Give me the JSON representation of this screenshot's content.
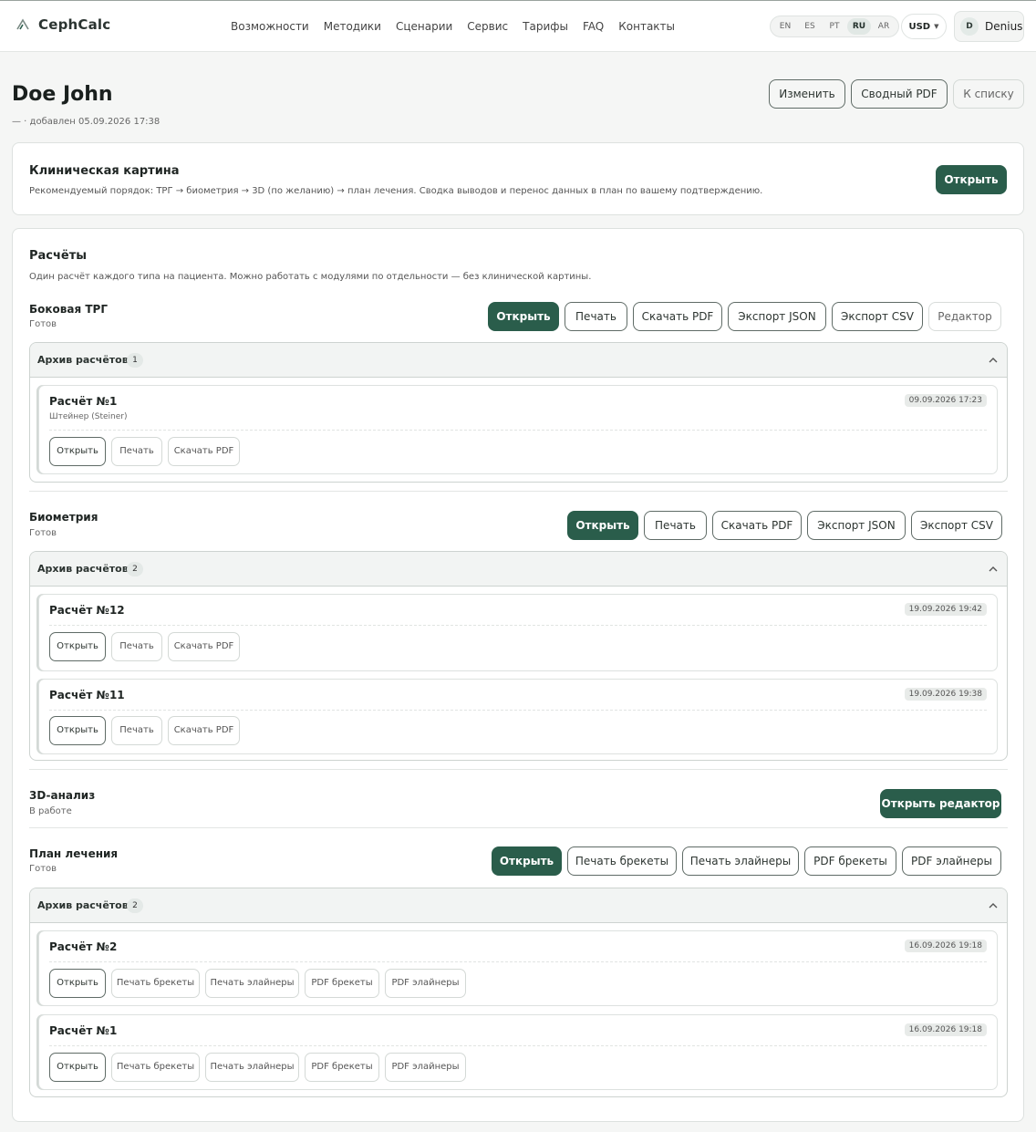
{
  "app": {
    "brand": "CephCalc"
  },
  "nav": [
    "Возможности",
    "Методики",
    "Сценарии",
    "Сервис",
    "Тарифы",
    "FAQ",
    "Контакты"
  ],
  "languages": {
    "items": [
      "EN",
      "ES",
      "PT",
      "RU",
      "AR"
    ],
    "active": "RU"
  },
  "currency": "USD",
  "user": {
    "initial": "D",
    "name": "Denius"
  },
  "patient": {
    "name": "Doe John",
    "subtitle": "— · добавлен 05.09.2026 17:38"
  },
  "header_actions": {
    "edit": "Изменить",
    "summary_pdf": "Сводный PDF",
    "back": "К списку"
  },
  "clinical": {
    "title": "Клиническая картина",
    "description": "Рекомендуемый порядок: ТРГ → биометрия → 3D (по желанию) → план лечения. Сводка выводов и перенос данных в план по вашему подтверждению.",
    "open": "Открыть"
  },
  "calcs": {
    "title": "Расчёты",
    "description": "Один расчёт каждого типа на пациента. Можно работать с модулями по отдельности — без клинической картины.",
    "archive_title": "Архив расчётов",
    "trg": {
      "name": "Боковая ТРГ",
      "status": "Готов",
      "buttons": [
        "Открыть",
        "Печать",
        "Скачать PDF",
        "Экспорт JSON",
        "Экспорт CSV",
        "Редактор"
      ],
      "archive_count": "1",
      "items": [
        {
          "title": "Расчёт №1",
          "method": "Штейнер (Steiner)",
          "date": "09.09.2026 17:23",
          "buttons": [
            "Открыть",
            "Печать",
            "Скачать PDF"
          ]
        }
      ]
    },
    "bio": {
      "name": "Биометрия",
      "status": "Готов",
      "buttons": [
        "Открыть",
        "Печать",
        "Скачать PDF",
        "Экспорт JSON",
        "Экспорт CSV"
      ],
      "archive_count": "2",
      "items": [
        {
          "title": "Расчёт №12",
          "date": "19.09.2026 19:42",
          "buttons": [
            "Открыть",
            "Печать",
            "Скачать PDF"
          ]
        },
        {
          "title": "Расчёт №11",
          "date": "19.09.2026 19:38",
          "buttons": [
            "Открыть",
            "Печать",
            "Скачать PDF"
          ]
        }
      ]
    },
    "analysis3d": {
      "name": "3D-анализ",
      "status": "В работе",
      "button": "Открыть редактор"
    },
    "plan": {
      "name": "План лечения",
      "status": "Готов",
      "buttons": [
        "Открыть",
        "Печать брекеты",
        "Печать элайнеры",
        "PDF брекеты",
        "PDF элайнеры"
      ],
      "archive_count": "2",
      "items": [
        {
          "title": "Расчёт №2",
          "date": "16.09.2026 19:18",
          "buttons": [
            "Открыть",
            "Печать брекеты",
            "Печать элайнеры",
            "PDF брекеты",
            "PDF элайнеры"
          ]
        },
        {
          "title": "Расчёт №1",
          "date": "16.09.2026 19:18",
          "buttons": [
            "Открыть",
            "Печать брекеты",
            "Печать элайнеры",
            "PDF брекеты",
            "PDF элайнеры"
          ]
        }
      ]
    }
  },
  "colors": {
    "accent": "#2a5d4b",
    "border": "#dde1df",
    "background": "#f5f6f5"
  }
}
